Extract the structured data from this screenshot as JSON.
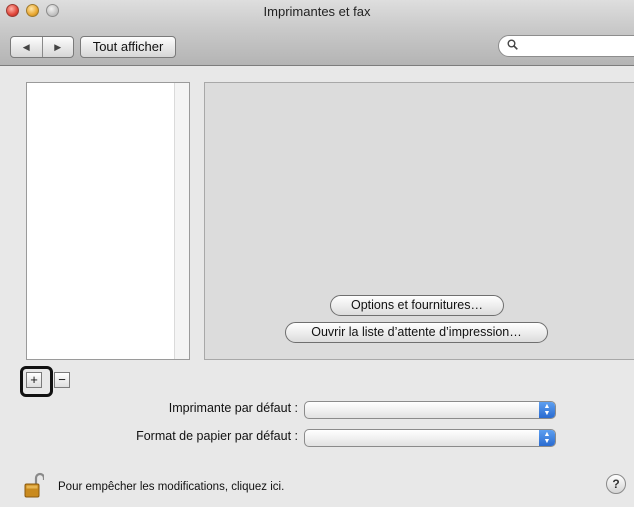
{
  "window": {
    "title": "Imprimantes et fax"
  },
  "toolbar": {
    "back_icon": "triangle-left",
    "forward_icon": "triangle-right",
    "show_all_label": "Tout afficher",
    "search": {
      "icon": "magnifier",
      "value": "",
      "placeholder": ""
    }
  },
  "printer_list": {
    "items": []
  },
  "details": {
    "options_button": "Options et fournitures…",
    "queue_button": "Ouvrir la liste d’attente d’impression…"
  },
  "list_controls": {
    "add_label": "+",
    "remove_label": "−"
  },
  "defaults": {
    "printer_label": "Imprimante par défaut :",
    "printer_value": "",
    "paper_label": "Format de papier par défaut :",
    "paper_value": ""
  },
  "footer": {
    "lock_icon": "unlocked-padlock",
    "lock_message": "Pour empêcher les modifications, cliquez ici.",
    "help_label": "?"
  },
  "colors": {
    "highlight_border": "#111111",
    "popup_arrow": "#2a6bd0"
  }
}
